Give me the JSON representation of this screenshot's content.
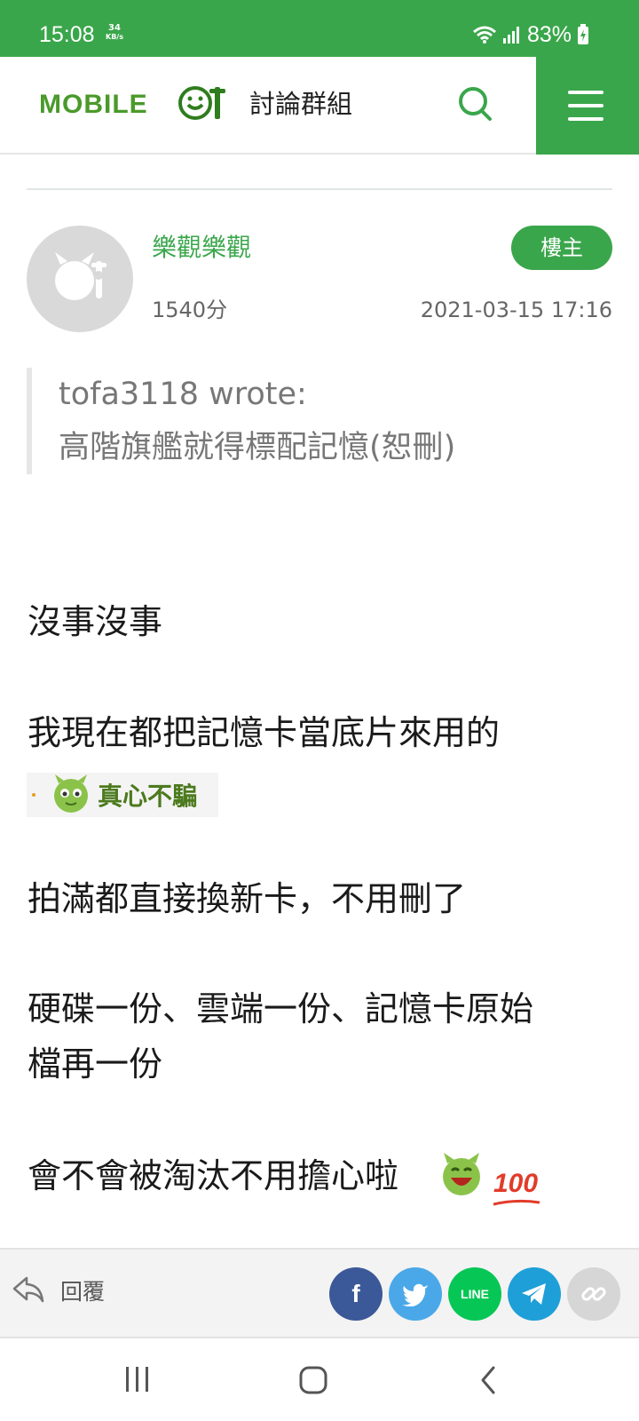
{
  "status_bar": {
    "time": "15:08",
    "speed_value": "34",
    "speed_unit": "KB/s",
    "battery": "83%"
  },
  "header": {
    "logo": "MOBILE01",
    "section_title": "討論群組"
  },
  "post": {
    "author": "樂觀樂觀",
    "badge": "樓主",
    "points": "1540分",
    "timestamp": "2021-03-15 17:16",
    "quote": {
      "author_line": "tofa3118 wrote:",
      "text": "高階旗艦就得標配記憶(恕刪)"
    },
    "body": {
      "line1": "沒事沒事",
      "line2": "我現在都把記憶卡當底片來用的",
      "sticker_text": "真心不騙",
      "line3": "拍滿都直接換新卡，不用刪了",
      "line4a": "硬碟一份、雲端一份、記憶卡原始",
      "line4b": "檔再一份",
      "line5": "會不會被淘汰不用擔心啦",
      "emoji_100": "100"
    }
  },
  "action_bar": {
    "reply_label": "回覆",
    "share": {
      "facebook": "f",
      "line": "LINE"
    }
  },
  "colors": {
    "brand_green": "#3aa64b",
    "facebook": "#3b5998",
    "twitter": "#4aa8e8",
    "line": "#06c755",
    "telegram": "#1f9fd8",
    "link": "#d6d6d6"
  }
}
